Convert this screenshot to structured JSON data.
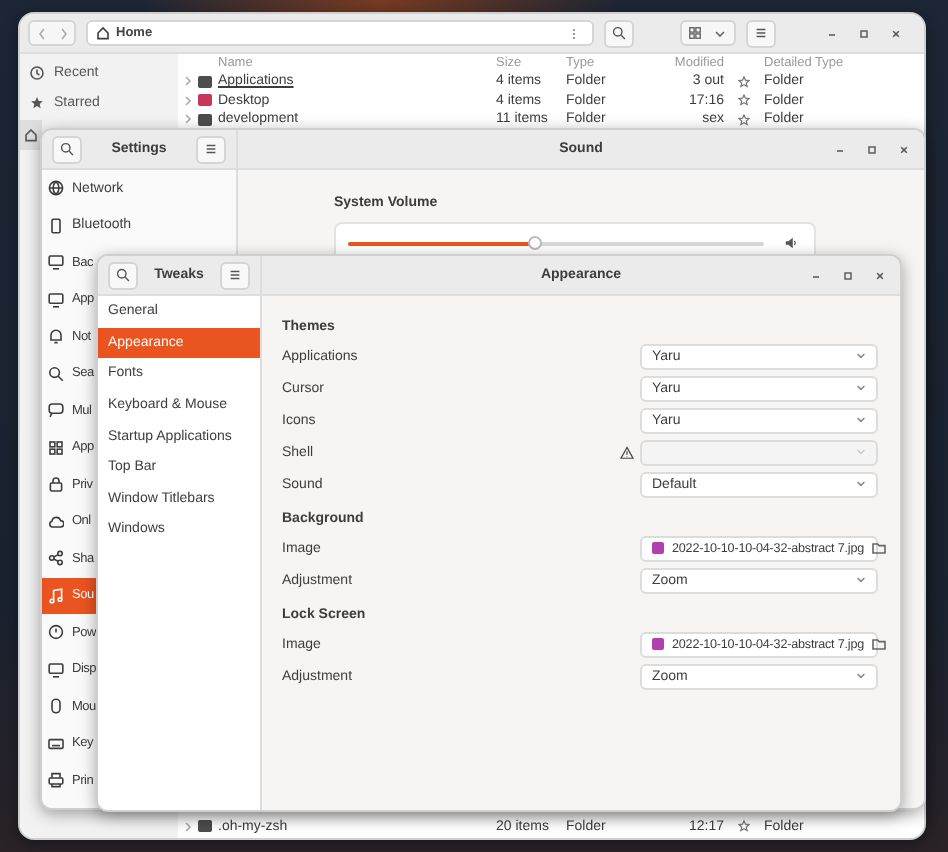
{
  "files": {
    "path": "Home",
    "sidebar": [
      {
        "label": "Recent",
        "selected": false
      },
      {
        "label": "Starred",
        "selected": false
      },
      {
        "selected": true
      }
    ],
    "columns": [
      "Name",
      "Size",
      "Type",
      "Modified",
      "Detailed Type"
    ],
    "rows": [
      {
        "name": "Applications",
        "size": "4 items",
        "type": "Folder",
        "modified": "3 out",
        "detailed_type": "Folder",
        "color": "#4d4d4d",
        "hovered": true,
        "starred": false
      },
      {
        "name": "Desktop",
        "size": "4 items",
        "type": "Folder",
        "modified": "17:16",
        "detailed_type": "Folder",
        "color": "#c7375a",
        "hovered": false,
        "starred": false
      },
      {
        "name": "development",
        "size": "11 items",
        "type": "Folder",
        "modified": "sex",
        "detailed_type": "Folder",
        "color": "#4d4d4d",
        "hovered": false,
        "starred": false
      }
    ],
    "bottom_rows": [
      {
        "name": ".oh-my-zsh",
        "size": "20 items",
        "type": "Folder",
        "modified": "12:17",
        "detailed_type": "Folder",
        "color": "#4d4d4d",
        "hovered": false,
        "starred": false
      }
    ]
  },
  "settings": {
    "title": "Settings",
    "panel_title": "Sound",
    "sidebar": [
      {
        "label": "Network",
        "selected": false
      },
      {
        "label": "Bluetooth",
        "selected": false
      },
      {
        "label": "Bac",
        "selected": false
      },
      {
        "label": "App",
        "selected": false
      },
      {
        "label": "Not",
        "selected": false
      },
      {
        "label": "Sea",
        "selected": false
      },
      {
        "label": "Mul",
        "selected": false
      },
      {
        "label": "App",
        "selected": false
      },
      {
        "label": "Priv",
        "selected": false
      },
      {
        "label": "Onl",
        "selected": false
      },
      {
        "label": "Sha",
        "selected": false
      },
      {
        "label": "Sou",
        "selected": true
      },
      {
        "label": "Pow",
        "selected": false
      },
      {
        "label": "Disp",
        "selected": false
      },
      {
        "label": "Mou",
        "selected": false
      },
      {
        "label": "Key",
        "selected": false
      },
      {
        "label": "Prin",
        "selected": false
      }
    ],
    "volume": {
      "label": "System Volume",
      "level": 0.45
    }
  },
  "tweaks": {
    "title": "Tweaks",
    "panel_title": "Appearance",
    "sidebar": [
      {
        "label": "General",
        "selected": false
      },
      {
        "label": "Appearance",
        "selected": true
      },
      {
        "label": "Fonts",
        "selected": false
      },
      {
        "label": "Keyboard & Mouse",
        "selected": false
      },
      {
        "label": "Startup Applications",
        "selected": false
      },
      {
        "label": "Top Bar",
        "selected": false
      },
      {
        "label": "Window Titlebars",
        "selected": false
      },
      {
        "label": "Windows",
        "selected": false
      }
    ],
    "sections": [
      {
        "title": "Themes",
        "rows": [
          {
            "label": "Applications",
            "kind": "dropdown",
            "value": "Yaru",
            "warning": false,
            "disabled": false
          },
          {
            "label": "Cursor",
            "kind": "dropdown",
            "value": "Yaru",
            "warning": false,
            "disabled": false
          },
          {
            "label": "Icons",
            "kind": "dropdown",
            "value": "Yaru",
            "warning": false,
            "disabled": false
          },
          {
            "label": "Shell",
            "kind": "dropdown",
            "warning": true,
            "disabled": true
          },
          {
            "label": "Sound",
            "kind": "dropdown",
            "value": "Default",
            "warning": false,
            "disabled": false
          }
        ]
      },
      {
        "title": "Background",
        "rows": [
          {
            "label": "Image",
            "kind": "file",
            "value": "2022-10-10-10-04-32-abstract 7.jpg"
          },
          {
            "label": "Adjustment",
            "kind": "dropdown",
            "value": "Zoom",
            "warning": false,
            "disabled": false
          }
        ]
      },
      {
        "title": "Lock Screen",
        "rows": [
          {
            "label": "Image",
            "kind": "file",
            "value": "2022-10-10-10-04-32-abstract 7.jpg"
          },
          {
            "label": "Adjustment",
            "kind": "dropdown",
            "value": "Zoom",
            "warning": false,
            "disabled": false
          }
        ]
      }
    ]
  }
}
